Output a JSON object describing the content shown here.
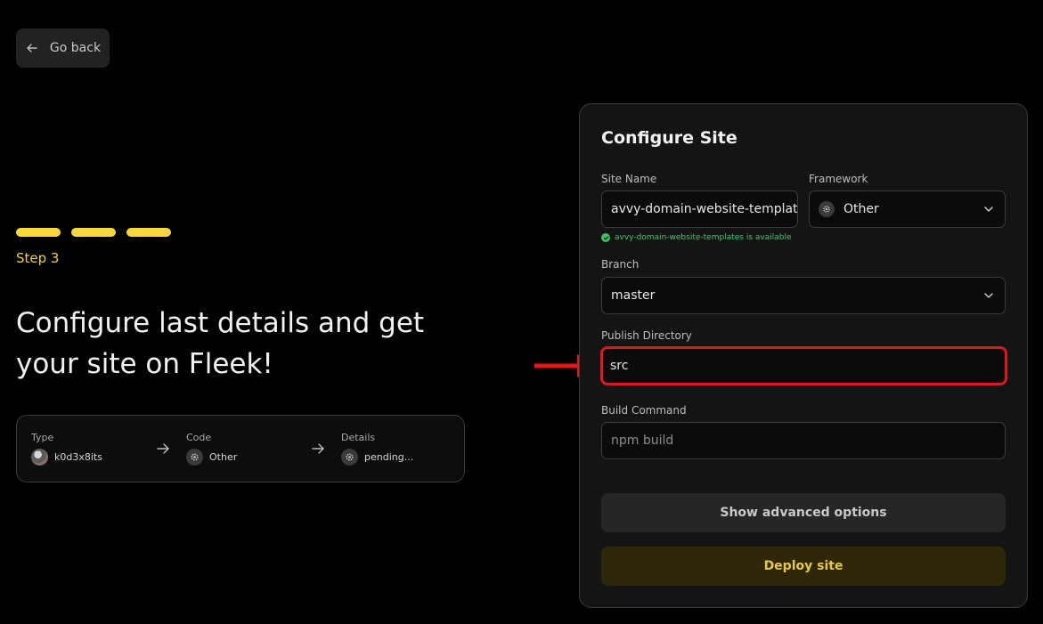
{
  "nav": {
    "go_back_label": "Go back"
  },
  "progress": {
    "step_label": "Step 3",
    "steps_total": 3,
    "steps_completed": 3,
    "accent": "#f6d83b"
  },
  "hero": {
    "heading_line1": "Configure last details and get",
    "heading_line2": "your site on Fleek!"
  },
  "summary": {
    "items": [
      {
        "label": "Type",
        "value": "k0d3x8its",
        "icon": "avatar"
      },
      {
        "label": "Code",
        "value": "Other",
        "icon": "gear-icon"
      },
      {
        "label": "Details",
        "value": "pending...",
        "icon": "gear-icon"
      }
    ]
  },
  "panel": {
    "title": "Configure Site",
    "site_name": {
      "label": "Site Name",
      "value": "avvy-domain-website-templates",
      "availability": "avvy-domain-website-templates is available"
    },
    "framework": {
      "label": "Framework",
      "value": "Other"
    },
    "branch": {
      "label": "Branch",
      "value": "master"
    },
    "publish_directory": {
      "label": "Publish Directory",
      "value": "src"
    },
    "build_command": {
      "label": "Build Command",
      "placeholder": "npm build"
    },
    "advanced_button": "Show advanced options",
    "deploy_button": "Deploy site"
  },
  "colors": {
    "highlight": "#e01818",
    "success": "#3fbf62",
    "deploy_text": "#e8c84a"
  }
}
